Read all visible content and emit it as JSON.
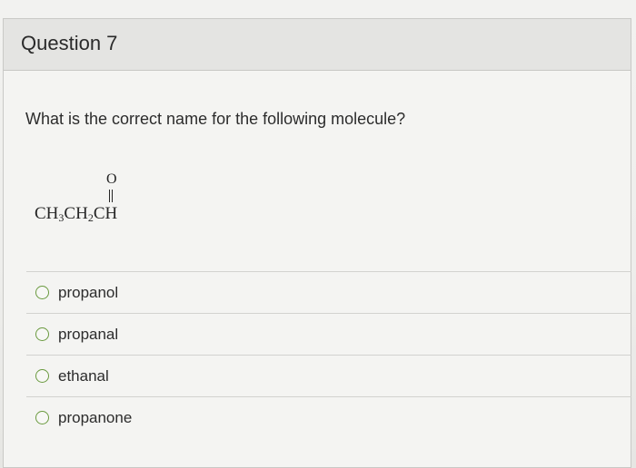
{
  "question": {
    "title": "Question 7",
    "prompt": "What is the correct name for the following molecule?",
    "molecule": {
      "oxygen": "O",
      "parts": [
        "CH",
        "3",
        "CH",
        "2",
        "CH"
      ]
    },
    "options": [
      {
        "label": "propanol",
        "selected": false
      },
      {
        "label": "propanal",
        "selected": false
      },
      {
        "label": "ethanal",
        "selected": false
      },
      {
        "label": "propanone",
        "selected": false
      }
    ]
  },
  "colors": {
    "radio_border": "#6a9a3f",
    "header_bg": "#e4e4e2"
  }
}
